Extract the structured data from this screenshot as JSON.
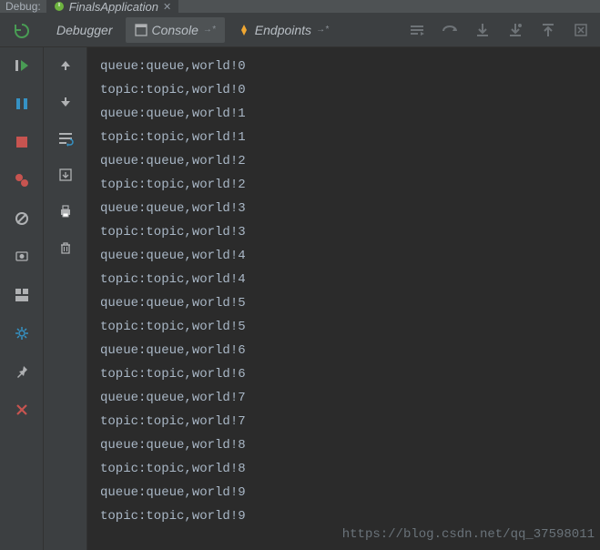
{
  "top": {
    "label": "Debug:",
    "run_config_name": "FinalsApplication"
  },
  "tabs": {
    "debugger": "Debugger",
    "console": "Console",
    "endpoints": "Endpoints"
  },
  "console_output": [
    "queue:queue,world!0",
    "topic:topic,world!0",
    "queue:queue,world!1",
    "topic:topic,world!1",
    "queue:queue,world!2",
    "topic:topic,world!2",
    "queue:queue,world!3",
    "topic:topic,world!3",
    "queue:queue,world!4",
    "topic:topic,world!4",
    "queue:queue,world!5",
    "topic:topic,world!5",
    "queue:queue,world!6",
    "topic:topic,world!6",
    "queue:queue,world!7",
    "topic:topic,world!7",
    "queue:queue,world!8",
    "topic:topic,world!8",
    "queue:queue,world!9",
    "topic:topic,world!9"
  ],
  "watermark": "https://blog.csdn.net/qq_37598011",
  "colors": {
    "bg_outer": "#3c3f41",
    "bg_console": "#2b2b2b",
    "text_console": "#a9b7c6",
    "tab_active": "#4e5254",
    "accent_green": "#499c54",
    "accent_blue": "#3592c4",
    "accent_red": "#c75450",
    "accent_orange": "#f0a732",
    "icon_gray": "#afb1b3"
  }
}
